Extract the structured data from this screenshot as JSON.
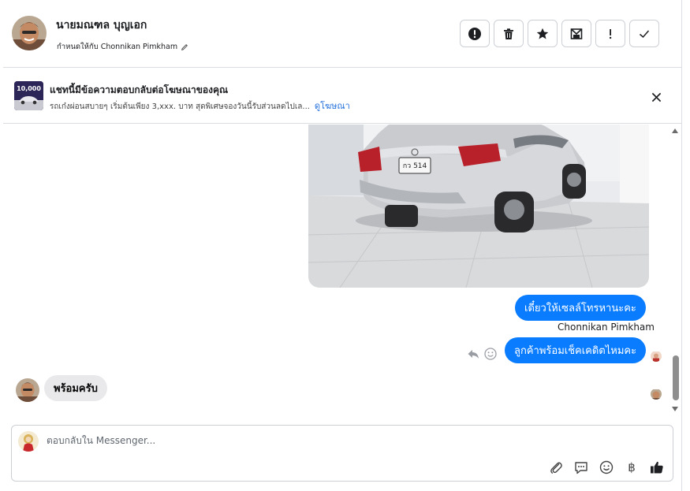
{
  "header": {
    "contact_name": "นายมณฑล บุญเอก",
    "assigned_text": "กำหนดให้กับ Chonnikan Pimkham",
    "actions": [
      {
        "name": "spam-report-button",
        "icon": "alert-circle-icon"
      },
      {
        "name": "delete-button",
        "icon": "trash-icon"
      },
      {
        "name": "star-button",
        "icon": "star-icon"
      },
      {
        "name": "mark-unread-button",
        "icon": "envelope-icon"
      },
      {
        "name": "follow-up-button",
        "icon": "exclamation-icon"
      },
      {
        "name": "mark-done-button",
        "icon": "check-icon"
      }
    ]
  },
  "ad": {
    "title": "แชทนี้มีข้อความตอบกลับต่อโฆษณาของคุณ",
    "subtitle": "รถเก๋งผ่อนสบายๆ เริ่มต้นเพียง 3,xxx. บาท สุดพิเศษจองวันนี้รับส่วนลดไปเล...",
    "link_label": "ดูโฆษณา",
    "thumb_text": "10,000",
    "close_icon": "close-icon"
  },
  "conversation": {
    "photo": {
      "plate": "กว 514",
      "icon": "car-photo"
    },
    "messages_out": [
      {
        "text": "เดี๋ยวให้เซลล์โทรหานะคะ"
      },
      {
        "text": "ลูกค้าพร้อมเช็คเคดิตไหมคะ"
      }
    ],
    "sender_label": "Chonnikan Pimkham",
    "message_in": "พร้อมครับ"
  },
  "composer": {
    "placeholder": "ตอบกลับใน Messenger...",
    "tools": [
      "paperclip-icon",
      "saved-reply-icon",
      "emoji-icon",
      "baht-icon",
      "thumbs-up-icon"
    ],
    "baht_symbol": "฿"
  },
  "colors": {
    "accent": "#0a7cff",
    "incoming_bubble": "#e9e9eb",
    "link": "#216fdb"
  }
}
